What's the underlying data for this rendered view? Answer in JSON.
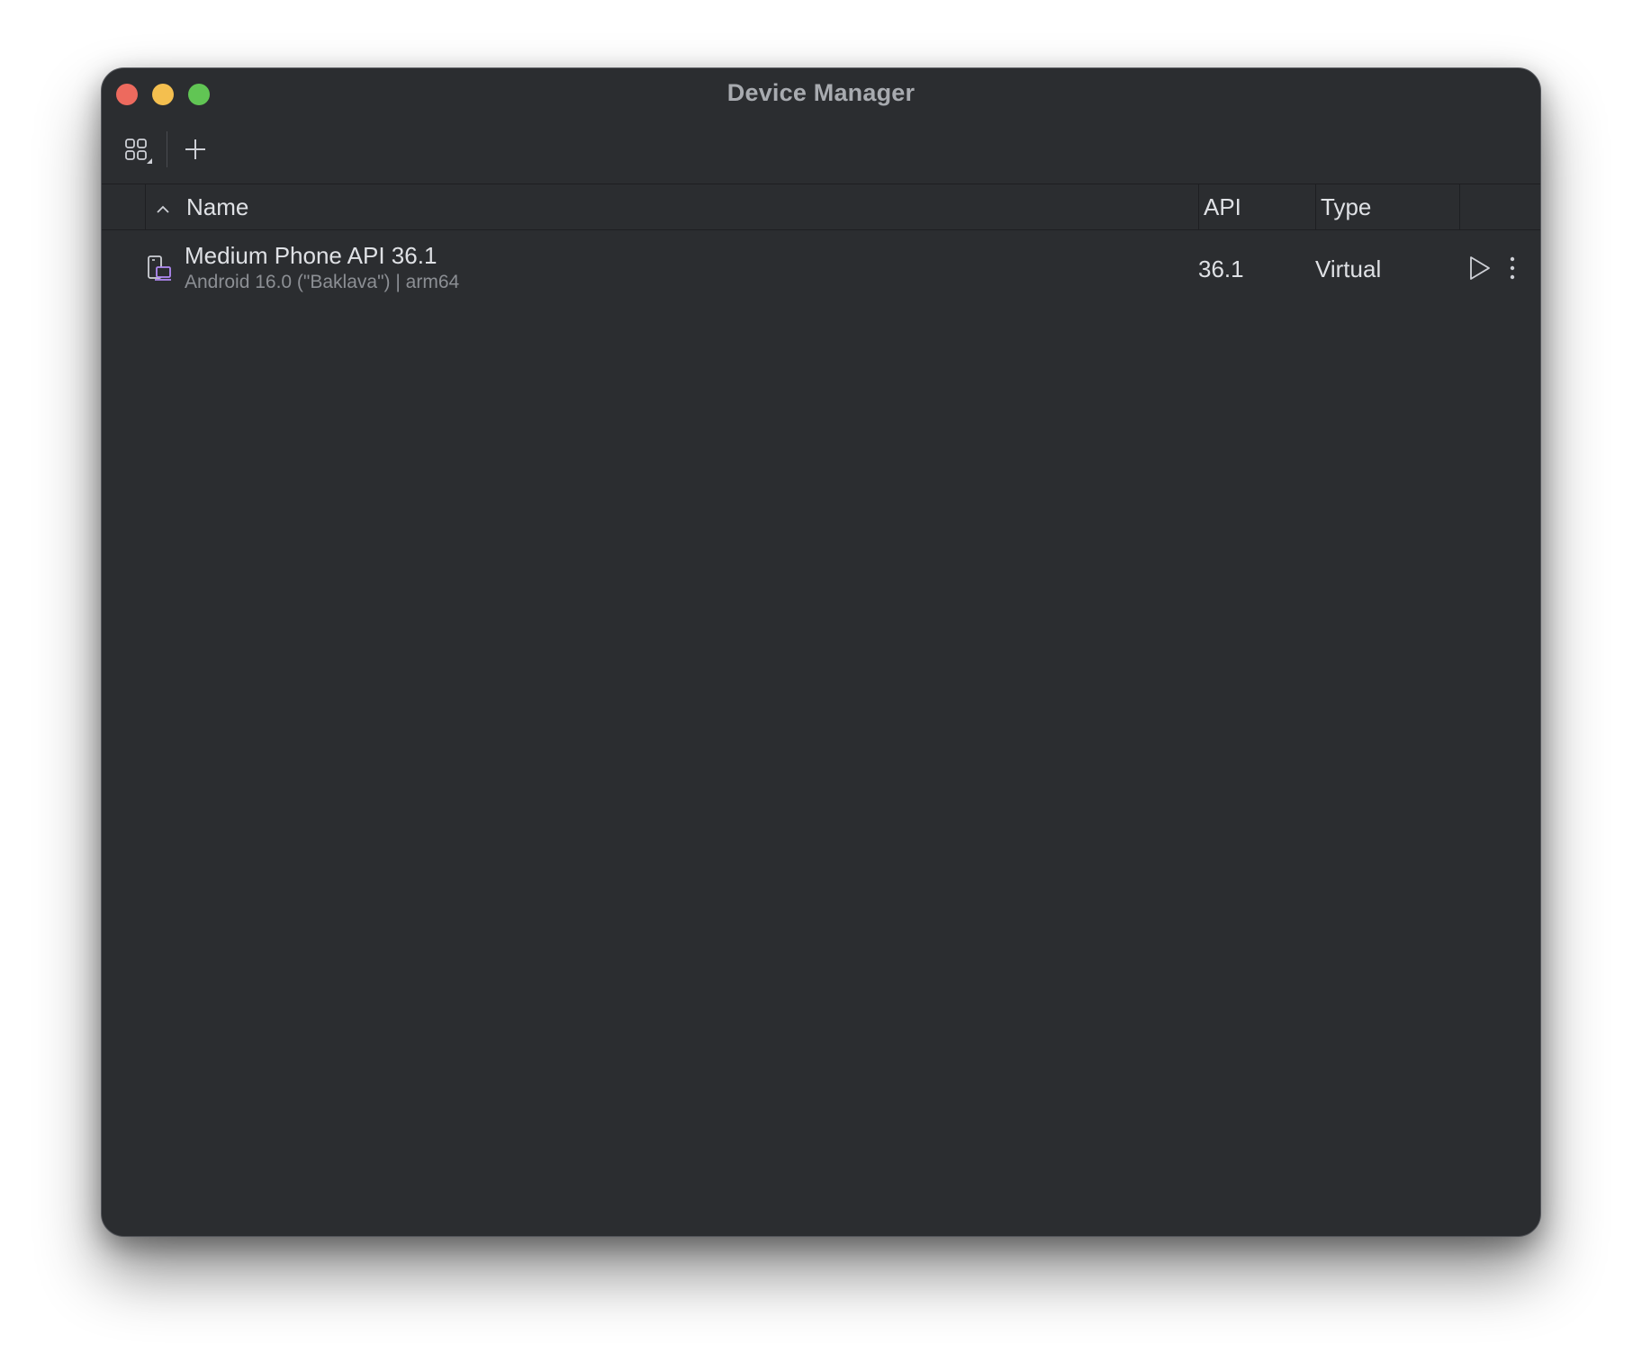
{
  "window": {
    "title": "Device Manager"
  },
  "toolbar": {
    "grid_icon": "grid-view-icon",
    "add_icon": "plus-icon"
  },
  "table": {
    "columns": [
      {
        "label": "Name",
        "sort": "ascending"
      },
      {
        "label": "API"
      },
      {
        "label": "Type"
      }
    ],
    "rows": [
      {
        "icon": "virtual-phone-icon",
        "name": "Medium Phone API 36.1",
        "details": "Android 16.0 (\"Baklava\") | arm64",
        "api": "36.1",
        "type": "Virtual",
        "actions": [
          "play-icon",
          "more-vertical-icon"
        ]
      }
    ]
  },
  "colors": {
    "window_bg": "#2b2d30",
    "text_primary": "#dfe1e5",
    "text_secondary": "#8c8f94",
    "accent_purple": "#b189f5",
    "close": "#ed6a5e",
    "minimize": "#f4bf4f",
    "maximize": "#61c554"
  }
}
